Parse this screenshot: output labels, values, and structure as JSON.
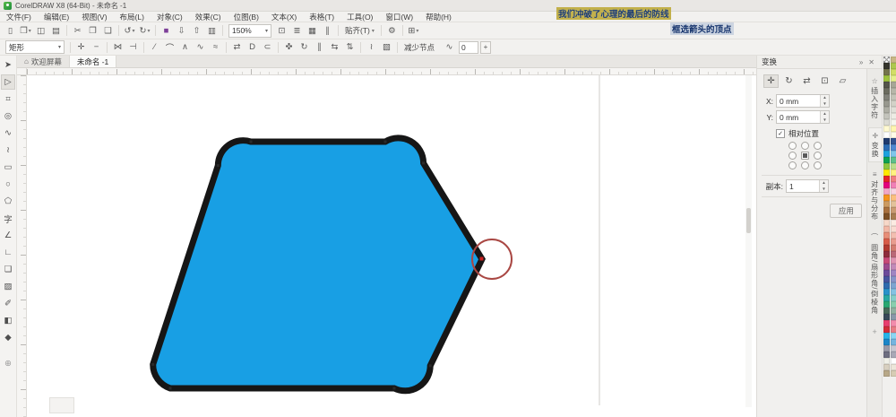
{
  "window": {
    "title": "CorelDRAW X8 (64-Bit) - 未命名 -1"
  },
  "menu": {
    "items": [
      "文件(F)",
      "编辑(E)",
      "视图(V)",
      "布局(L)",
      "对象(C)",
      "效果(C)",
      "位图(B)",
      "文本(X)",
      "表格(T)",
      "工具(O)",
      "窗口(W)",
      "帮助(H)"
    ]
  },
  "annotations": {
    "line1": "我们冲破了心理的最后的防线",
    "line2": "框选箭头的顶点"
  },
  "toolbar": {
    "zoom_level": "150%",
    "snap_label": "贴齐(T)",
    "options_glyph": "⚙",
    "launcher_glyph": "⊞",
    "icons_left": [
      {
        "name": "new-document-button",
        "glyph": "▯"
      },
      {
        "name": "open-button",
        "glyph": "❒",
        "dd": true
      },
      {
        "name": "save-button",
        "glyph": "◫"
      },
      {
        "name": "print-button",
        "glyph": "▤"
      },
      {
        "sep": true
      },
      {
        "name": "cut-button",
        "glyph": "✂"
      },
      {
        "name": "copy-button",
        "glyph": "❐"
      },
      {
        "name": "paste-button",
        "glyph": "❑"
      },
      {
        "sep": true
      },
      {
        "name": "undo-button",
        "glyph": "↺",
        "dd": true
      },
      {
        "name": "redo-button",
        "glyph": "↻",
        "dd": true
      },
      {
        "sep": true
      },
      {
        "name": "search-content-button",
        "glyph": "■",
        "color": "#7D3F98"
      },
      {
        "name": "import-button",
        "glyph": "⇩"
      },
      {
        "name": "export-button",
        "glyph": "⇧"
      },
      {
        "name": "publish-pdf-button",
        "glyph": "▥"
      },
      {
        "sep": true
      }
    ],
    "icons_view": [
      {
        "name": "full-screen-preview-button",
        "glyph": "⊡"
      },
      {
        "name": "show-rulers-button",
        "glyph": "≣"
      },
      {
        "name": "show-grid-button",
        "glyph": "▦"
      },
      {
        "name": "show-guidelines-button",
        "glyph": "∥"
      },
      {
        "sep": true
      }
    ]
  },
  "property_bar": {
    "marquee_mode": "矩形",
    "reduce_nodes_label": "减少节点",
    "smoothness_icon": "∿",
    "smoothness_value": "0",
    "stepper_glyph": "+",
    "icons": [
      {
        "name": "add-node-button",
        "glyph": "✛"
      },
      {
        "name": "delete-node-button",
        "glyph": "−"
      },
      {
        "sep": true
      },
      {
        "name": "join-nodes-button",
        "glyph": "⋈"
      },
      {
        "name": "break-curve-button",
        "glyph": "⊣"
      },
      {
        "sep": true
      },
      {
        "name": "convert-to-line-button",
        "glyph": "∕"
      },
      {
        "name": "convert-to-curve-button",
        "glyph": "⌒"
      },
      {
        "name": "cusp-node-button",
        "glyph": "∧"
      },
      {
        "name": "smooth-node-button",
        "glyph": "∿"
      },
      {
        "name": "symmetric-node-button",
        "glyph": "≈"
      },
      {
        "sep": true
      },
      {
        "name": "reverse-direction-button",
        "glyph": "⇄"
      },
      {
        "name": "close-curve-button",
        "glyph": "D"
      },
      {
        "name": "extract-subpath-button",
        "glyph": "⊂"
      },
      {
        "sep": true
      },
      {
        "name": "stretch-nodes-button",
        "glyph": "✜"
      },
      {
        "name": "rotate-skew-nodes-button",
        "glyph": "↻"
      },
      {
        "name": "align-nodes-button",
        "glyph": "∥"
      },
      {
        "name": "reflect-horizontal-button",
        "glyph": "⇆"
      },
      {
        "name": "reflect-vertical-button",
        "glyph": "⇅"
      },
      {
        "sep": true
      },
      {
        "name": "elastic-mode-button",
        "glyph": "≀"
      },
      {
        "name": "select-all-nodes-button",
        "glyph": "▧"
      },
      {
        "sep": true
      }
    ]
  },
  "tabs": {
    "welcome": "欢迎屏幕",
    "document": "未命名 -1",
    "home_glyph": "⌂"
  },
  "toolbox": {
    "tools": [
      {
        "name": "pick-tool",
        "glyph": "➤"
      },
      {
        "name": "shape-tool",
        "glyph": "▷",
        "active": true
      },
      {
        "name": "crop-tool",
        "glyph": "⌗"
      },
      {
        "name": "zoom-tool",
        "glyph": "◎"
      },
      {
        "name": "freehand-tool",
        "glyph": "∿"
      },
      {
        "name": "two-point-line-tool",
        "glyph": "≀"
      },
      {
        "name": "rectangle-tool",
        "glyph": "▭"
      },
      {
        "name": "ellipse-tool",
        "glyph": "○"
      },
      {
        "name": "polygon-tool",
        "glyph": "⬠"
      },
      {
        "name": "text-tool",
        "glyph": "字"
      },
      {
        "name": "dimension-tool",
        "glyph": "∠"
      },
      {
        "name": "connector-tool",
        "glyph": "∟"
      },
      {
        "name": "drop-shadow-tool",
        "glyph": "❏"
      },
      {
        "name": "transparency-tool",
        "glyph": "▨"
      },
      {
        "name": "color-eyedropper-tool",
        "glyph": "✐"
      },
      {
        "name": "interactive-fill-tool",
        "glyph": "◧"
      },
      {
        "name": "smart-fill-tool",
        "glyph": "◆"
      }
    ],
    "add_glyph": "⊕"
  },
  "docker": {
    "title": "变换",
    "collapse_glyph": "»",
    "close_glyph": "✕",
    "transform_icons": [
      {
        "name": "transform-position-button",
        "glyph": "✛",
        "active": true
      },
      {
        "name": "transform-rotate-button",
        "glyph": "↻"
      },
      {
        "name": "transform-scale-mirror-button",
        "glyph": "⇄"
      },
      {
        "name": "transform-size-button",
        "glyph": "⊡"
      },
      {
        "name": "transform-skew-button",
        "glyph": "▱"
      }
    ],
    "x_label": "X:",
    "x_value": "0 mm",
    "y_label": "Y:",
    "y_value": "0 mm",
    "relative_checkbox_label": "相对位置",
    "relative_checked_glyph": "✓",
    "anchor_grid": [
      false,
      false,
      false,
      false,
      true,
      false,
      false,
      false,
      false
    ],
    "copies_label": "副本:",
    "copies_value": "1",
    "apply_label": "应用"
  },
  "docker_tabs": {
    "items": [
      {
        "name": "docker-tab-insert-character",
        "icon": "☆",
        "label": "插入字符"
      },
      {
        "name": "docker-tab-transform",
        "icon": "✛",
        "label": "变换",
        "active": true
      },
      {
        "name": "docker-tab-align-distribute",
        "icon": "≡",
        "label": "对齐与分布"
      },
      {
        "name": "docker-tab-fillet-scallop-chamfer",
        "icon": "⌒",
        "label": "圆角/扇形角/倒棱角"
      }
    ],
    "add_glyph": "+"
  },
  "palette": {
    "colors": [
      "none",
      "#C9B784",
      "#34342C",
      "#AEC84E",
      "#74744C",
      "#D2DE66",
      "#9EC23E",
      "#E6F08E",
      "#54544A",
      "#A6A696",
      "#6C6C60",
      "#B6B6A8",
      "#82827A",
      "#C4C4B8",
      "#98988E",
      "#D2D2C8",
      "#AEAEA4",
      "#E0E0D8",
      "#C4C4BC",
      "#ECECE4",
      "#DCDCD4",
      "#F6F6EE",
      "#FFFAD2",
      "#FFF6B0",
      "#FFFFFF",
      "#FFFCE8",
      "#1F3A6E",
      "#335290",
      "#2C6CB4",
      "#5088D0",
      "#1CA2DE",
      "#7EC6EA",
      "#0CA251",
      "#5EC08A",
      "#8CC63F",
      "#BCDE8C",
      "#FFE900",
      "#FFF280",
      "#E62328",
      "#F07E80",
      "#E5007D",
      "#F080B6",
      "#F2A8C6",
      "#F8D4E2",
      "#F5941E",
      "#FAC080",
      "#CC9A60",
      "#E2C29A",
      "#A8703E",
      "#C99B72",
      "#7C4F24",
      "#A87D52",
      "#F7D8C8",
      "#FBEBE2",
      "#F2B8A6",
      "#F8DCD2",
      "#E88E78",
      "#F2BEB0",
      "#D85C48",
      "#E89C8E",
      "#B23A30",
      "#D27C70",
      "#8E2C3C",
      "#BA6878",
      "#C84A78",
      "#DE94B2",
      "#9C4A8E",
      "#C28AB8",
      "#6C4A9A",
      "#9E84C2",
      "#46549E",
      "#8694C8",
      "#2E6AAE",
      "#7CA4D0",
      "#2892CA",
      "#84C2E2",
      "#28A8A2",
      "#86CEC8",
      "#2AA872",
      "#88CEAE",
      "#486858",
      "#90B0A0",
      "#384858",
      "#8898A8",
      "#E83E6E",
      "#F28CAC",
      "#D22C38",
      "#E87C84",
      "#28B4E8",
      "#8CD6F2",
      "#1C86C8",
      "#74B4DE",
      "#9A9AA8",
      "#C8C8D2",
      "#6E6E80",
      "#A8A8B6",
      "#F0F0E8",
      "#FFFFFF",
      "#D8D0C0",
      "#ECE6DA",
      "#B8A888",
      "#D6CCB4"
    ]
  },
  "canvas": {
    "shape_fill": "#189FE4",
    "shape_stroke": "#161616",
    "node_color": "#2A2A2A",
    "selected_node_color": "#CC2222",
    "highlight_circle_color": "#A94743",
    "page_edge_color": "#CFCDC9"
  }
}
